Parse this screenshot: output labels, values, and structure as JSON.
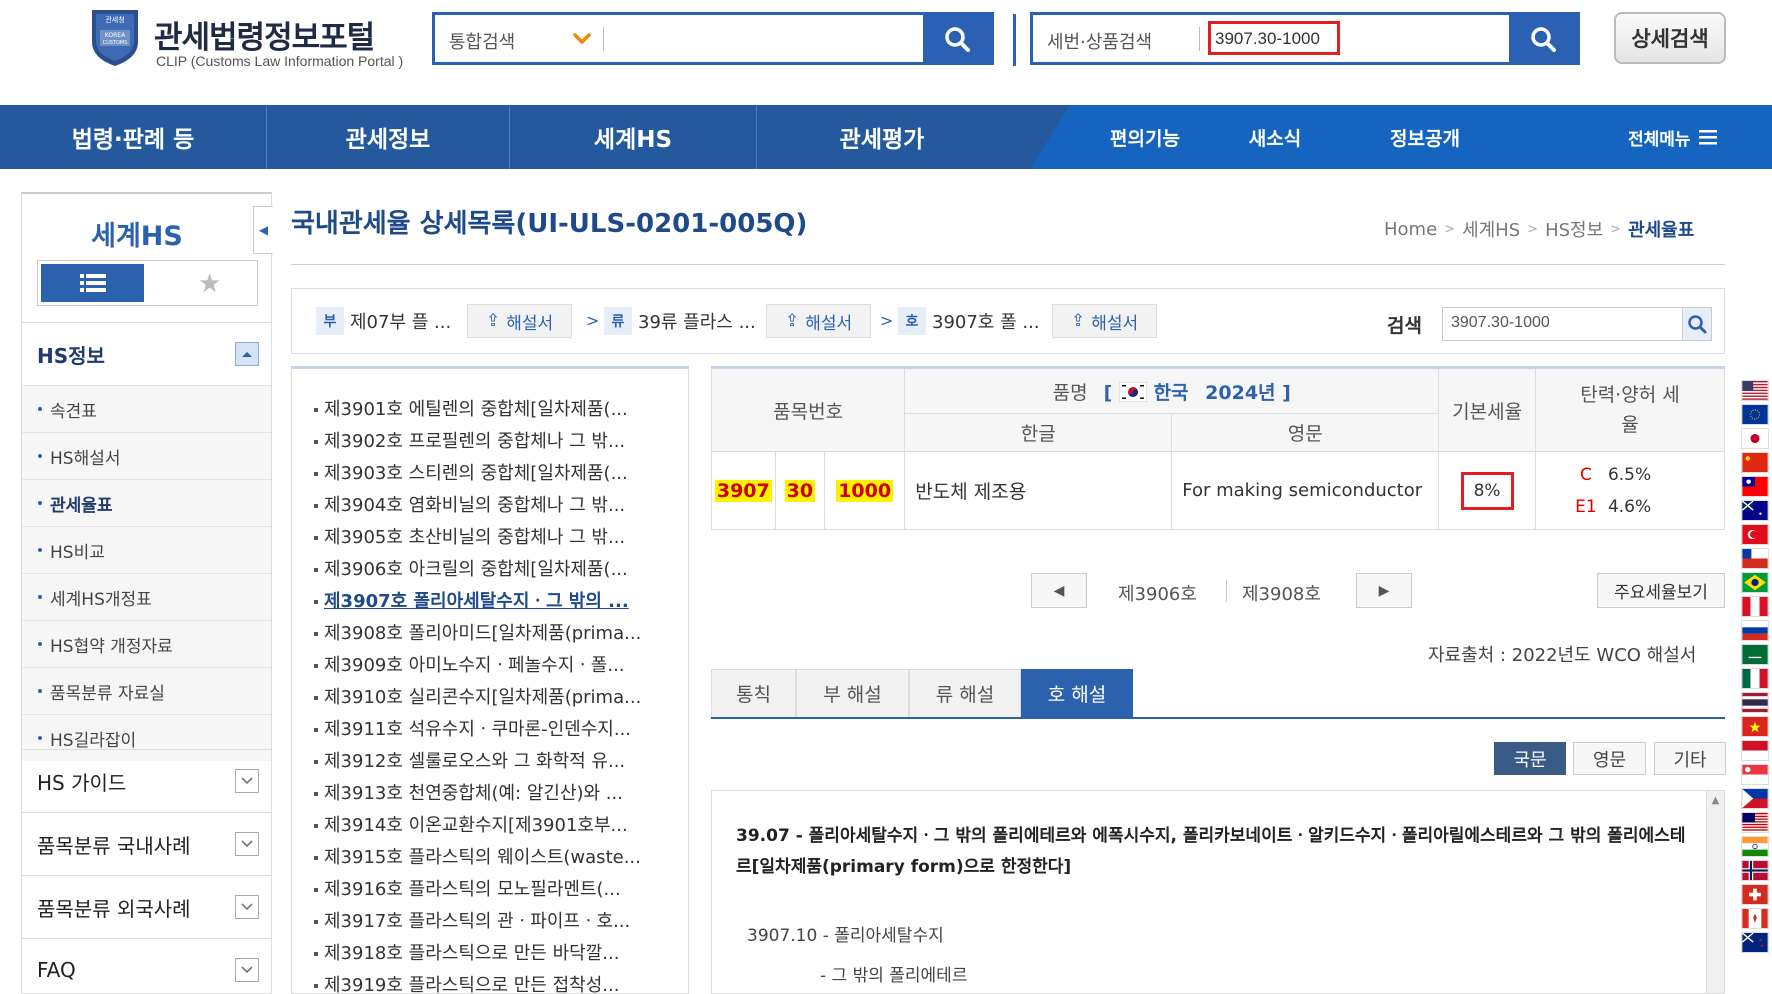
{
  "header": {
    "logo_title": "관세법령정보포털",
    "logo_subtitle": "CLIP (Customs Law Information Portal )",
    "logo_emblem_text": "관세청",
    "main_search": {
      "category": "통합검색",
      "placeholder": ""
    },
    "hs_search": {
      "label": "세번·상품검색",
      "value": "3907.30-1000"
    },
    "detail_search_label": "상세검색"
  },
  "gnb": {
    "items": [
      "법령·판례 등",
      "관세정보",
      "세계HS",
      "관세평가"
    ],
    "sub_items": [
      "편의기능",
      "새소식",
      "정보공개"
    ],
    "all_menu": "전체메뉴"
  },
  "sidebar": {
    "title": "세계HS",
    "groups": [
      {
        "label": "HS정보",
        "expanded": true,
        "items": [
          {
            "label": "속견표",
            "active": false
          },
          {
            "label": "HS해설서",
            "active": false
          },
          {
            "label": "관세율표",
            "active": true
          },
          {
            "label": "HS비교",
            "active": false
          },
          {
            "label": "세계HS개정표",
            "active": false
          },
          {
            "label": "HS협약 개정자료",
            "active": false
          },
          {
            "label": "품목분류 자료실",
            "active": false
          },
          {
            "label": "HS길라잡이",
            "active": false
          }
        ]
      },
      {
        "label": "HS 가이드",
        "expanded": false
      },
      {
        "label": "품목분류 국내사례",
        "expanded": false
      },
      {
        "label": "품목분류 외국사례",
        "expanded": false
      },
      {
        "label": "FAQ",
        "expanded": false
      }
    ]
  },
  "page": {
    "title": "국내관세율 상세목록(UI-ULS-0201-005Q)",
    "breadcrumb": [
      "Home",
      "세계HS",
      "HS정보",
      "관세율표"
    ]
  },
  "path": {
    "section": {
      "tag": "부",
      "label": "제07부 플 ..."
    },
    "chapter": {
      "tag": "류",
      "label": "39류 플라스 ..."
    },
    "heading": {
      "tag": "호",
      "label": "3907호 폴 ..."
    },
    "expl_button": "해설서",
    "search_label": "검색",
    "search_value": "3907.30-1000"
  },
  "heading_list": [
    {
      "label": "제3901호 에틸렌의 중합체[일차제품(...",
      "active": false
    },
    {
      "label": "제3902호 프로필렌의 중합체나 그 밖...",
      "active": false
    },
    {
      "label": "제3903호 스티렌의 중합체[일차제품(...",
      "active": false
    },
    {
      "label": "제3904호 염화비닐의 중합체나 그 밖...",
      "active": false
    },
    {
      "label": "제3905호 초산비닐의 중합체나 그 밖...",
      "active": false
    },
    {
      "label": "제3906호 아크릴의 중합체[일차제품(...",
      "active": false
    },
    {
      "label": "제3907호 폴리아세탈수지ㆍ그 밖의 ...",
      "active": true
    },
    {
      "label": "제3908호 폴리아미드[일차제품(prima...",
      "active": false
    },
    {
      "label": "제3909호 아미노수지ㆍ페놀수지ㆍ폴...",
      "active": false
    },
    {
      "label": "제3910호 실리콘수지[일차제품(prima...",
      "active": false
    },
    {
      "label": "제3911호 석유수지ㆍ쿠마론-인덴수지...",
      "active": false
    },
    {
      "label": "제3912호 셀룰로오스와 그 화학적 유...",
      "active": false
    },
    {
      "label": "제3913호 천연중합체(예: 알긴산)와 ...",
      "active": false
    },
    {
      "label": "제3914호 이온교환수지[제3901호부...",
      "active": false
    },
    {
      "label": "제3915호 플라스틱의 웨이스트(waste...",
      "active": false
    },
    {
      "label": "제3916호 플라스틱의 모노필라멘트(...",
      "active": false
    },
    {
      "label": "제3917호 플라스틱의 관ㆍ파이프ㆍ호...",
      "active": false
    },
    {
      "label": "제3918호 플라스틱으로 만든 바닥깔...",
      "active": false
    },
    {
      "label": "제3919호 플라스틱으로 만든 접착성...",
      "active": false
    }
  ],
  "tariff_table": {
    "headers": {
      "code": "품목번호",
      "name": "품명",
      "country": "한국",
      "year": "2024년",
      "korean": "한글",
      "english": "영문",
      "base_rate": "기본세율",
      "flex_rate": "탄력·양허 세율"
    },
    "row": {
      "code_parts": [
        "3907",
        "30",
        "1000"
      ],
      "korean": "반도체 제조용",
      "english": "For making semiconductor",
      "base_rate": "8%",
      "other_rates": [
        {
          "code": "C",
          "rate": "6.5%"
        },
        {
          "code": "E1",
          "rate": "4.6%"
        }
      ]
    }
  },
  "pager": {
    "prev": "제3906호",
    "next": "제3908호",
    "main_rates_button": "주요세율보기"
  },
  "source_text": "자료출처 : 2022년도 WCO 해설서",
  "tabs": [
    {
      "label": "통칙",
      "active": false
    },
    {
      "label": "부 해설",
      "active": false
    },
    {
      "label": "류 해설",
      "active": false
    },
    {
      "label": "호 해설",
      "active": true
    }
  ],
  "lang_buttons": [
    {
      "label": "국문",
      "active": true
    },
    {
      "label": "영문",
      "active": false
    },
    {
      "label": "기타",
      "active": false
    }
  ],
  "explanation": {
    "title": "39.07 - 폴리아세탈수지ㆍ그 밖의 폴리에테르와 에폭시수지, 폴리카보네이트ㆍ알키드수지ㆍ폴리아릴에스테르와 그 밖의 폴리에스테르[일차제품(primary form)으로 한정한다]",
    "lines": [
      "3907.10 - 폴리아세탈수지",
      "- 그 밖의 폴리에테르"
    ]
  },
  "colors": {
    "primary": "#2c62ad",
    "gnb_right": "#1565c0",
    "highlight_bg": "#fff200",
    "highlight_text": "#cc0000",
    "alert_border": "#e02020"
  },
  "flags": [
    "usa-flag-icon",
    "eu-flag-icon",
    "japan-flag-icon",
    "china-flag-icon",
    "taiwan-flag-icon",
    "australia-flag-icon",
    "turkey-flag-icon",
    "chile-flag-icon",
    "brazil-flag-icon",
    "peru-flag-icon",
    "russia-flag-icon",
    "saudi-flag-icon",
    "mexico-flag-icon",
    "thailand-flag-icon",
    "vietnam-flag-icon",
    "indonesia-flag-icon",
    "singapore-flag-icon",
    "philippines-flag-icon",
    "malaysia-flag-icon",
    "india-flag-icon",
    "norway-flag-icon",
    "switzerland-flag-icon",
    "canada-flag-icon",
    "newzealand-flag-icon"
  ]
}
